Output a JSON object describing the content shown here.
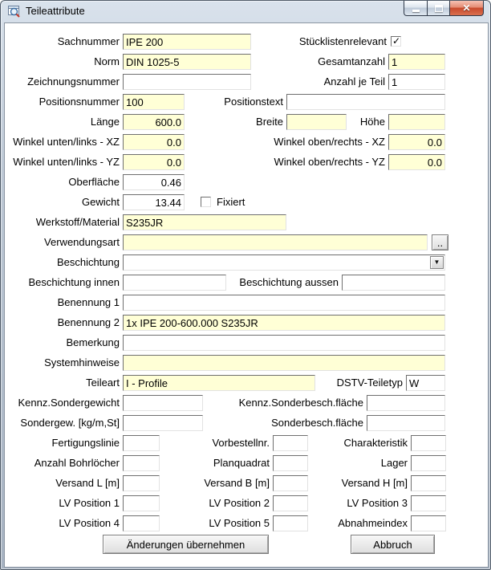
{
  "window": {
    "title": "Teileattribute"
  },
  "colors": {
    "field_yellow": "#ffffd6",
    "close_red": "#c84a2c"
  },
  "fields": {
    "sachnummer": {
      "label": "Sachnummer",
      "value": "IPE 200"
    },
    "norm": {
      "label": "Norm",
      "value": "DIN 1025-5"
    },
    "zeichnungsnummer": {
      "label": "Zeichnungsnummer",
      "value": ""
    },
    "stuecklistenrelevant": {
      "label": "Stücklistenrelevant",
      "checked": true
    },
    "gesamtanzahl": {
      "label": "Gesamtanzahl",
      "value": "1"
    },
    "anzahl_je_teil": {
      "label": "Anzahl je Teil",
      "value": "1"
    },
    "positionsnummer": {
      "label": "Positionsnummer",
      "value": "100"
    },
    "positionstext": {
      "label": "Positionstext",
      "value": ""
    },
    "laenge": {
      "label": "Länge",
      "value": "600.0"
    },
    "breite": {
      "label": "Breite",
      "value": ""
    },
    "hoehe": {
      "label": "Höhe",
      "value": ""
    },
    "winkel_ul_xz": {
      "label": "Winkel unten/links - XZ",
      "value": "0.0"
    },
    "winkel_or_xz": {
      "label": "Winkel oben/rechts - XZ",
      "value": "0.0"
    },
    "winkel_ul_yz": {
      "label": "Winkel unten/links - YZ",
      "value": "0.0"
    },
    "winkel_or_yz": {
      "label": "Winkel oben/rechts - YZ",
      "value": "0.0"
    },
    "oberflaeche": {
      "label": "Oberfläche",
      "value": "0.46"
    },
    "gewicht": {
      "label": "Gewicht",
      "value": "13.44"
    },
    "fixiert": {
      "label": "Fixiert",
      "checked": false
    },
    "werkstoff": {
      "label": "Werkstoff/Material",
      "value": "S235JR"
    },
    "verwendungsart": {
      "label": "Verwendungsart",
      "value": ""
    },
    "beschichtung": {
      "label": "Beschichtung",
      "value": ""
    },
    "beschichtung_innen": {
      "label": "Beschichtung innen",
      "value": ""
    },
    "beschichtung_aussen": {
      "label": "Beschichtung aussen",
      "value": ""
    },
    "benennung1": {
      "label": "Benennung 1",
      "value": ""
    },
    "benennung2": {
      "label": "Benennung 2",
      "value": "1x IPE 200-600.000 S235JR"
    },
    "bemerkung": {
      "label": "Bemerkung",
      "value": ""
    },
    "systemhinweise": {
      "label": "Systemhinweise",
      "value": ""
    },
    "teileart": {
      "label": "Teileart",
      "value": "I - Profile"
    },
    "dstv_teiletyp": {
      "label": "DSTV-Teiletyp",
      "value": "W"
    },
    "kennz_sondergewicht": {
      "label": "Kennz.Sondergewicht",
      "value": ""
    },
    "kennz_sonderbesch": {
      "label": "Kennz.Sonderbesch.fläche",
      "value": ""
    },
    "sondergew": {
      "label": "Sondergew. [kg/m,St]",
      "value": ""
    },
    "sonderbesch": {
      "label": "Sonderbesch.fläche",
      "value": ""
    },
    "fertigungslinie": {
      "label": "Fertigungslinie",
      "value": ""
    },
    "vorbestellnr": {
      "label": "Vorbestellnr.",
      "value": ""
    },
    "charakteristik": {
      "label": "Charakteristik",
      "value": ""
    },
    "anzahl_bohrloecher": {
      "label": "Anzahl Bohrlöcher",
      "value": ""
    },
    "planquadrat": {
      "label": "Planquadrat",
      "value": ""
    },
    "lager": {
      "label": "Lager",
      "value": ""
    },
    "versand_l": {
      "label": "Versand L [m]",
      "value": ""
    },
    "versand_b": {
      "label": "Versand B [m]",
      "value": ""
    },
    "versand_h": {
      "label": "Versand H [m]",
      "value": ""
    },
    "lv1": {
      "label": "LV Position 1",
      "value": ""
    },
    "lv2": {
      "label": "LV Position 2",
      "value": ""
    },
    "lv3": {
      "label": "LV Position 3",
      "value": ""
    },
    "lv4": {
      "label": "LV Position 4",
      "value": ""
    },
    "lv5": {
      "label": "LV Position 5",
      "value": ""
    },
    "abnahmeindex": {
      "label": "Abnahmeindex",
      "value": ""
    }
  },
  "buttons": {
    "apply": "Änderungen übernehmen",
    "cancel": "Abbruch",
    "browse": "..",
    "dropdown_arrow": "▼"
  }
}
